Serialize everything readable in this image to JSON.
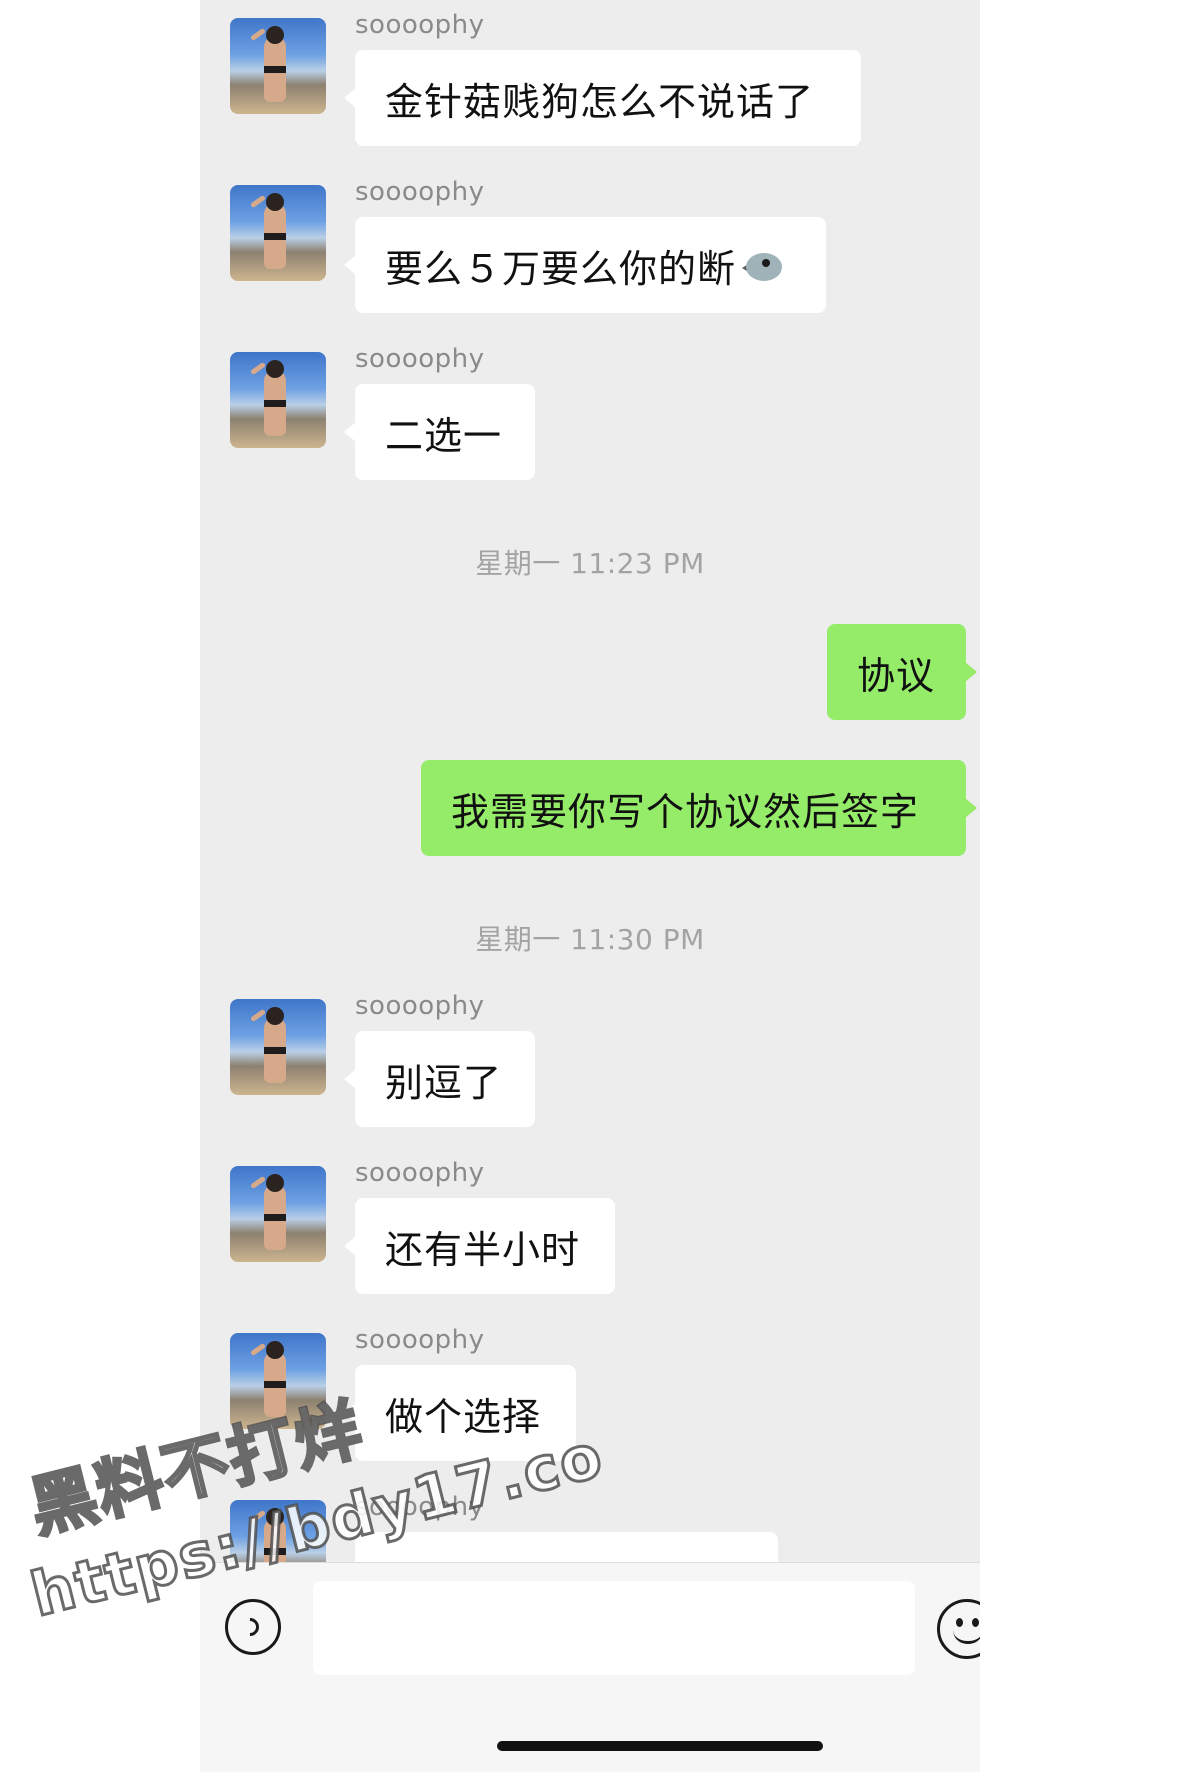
{
  "sender_name": "soooophy",
  "messages": [
    {
      "type": "in",
      "sender": "soooophy",
      "text": "金针菇贱狗怎么不说话了"
    },
    {
      "type": "in",
      "sender": "soooophy",
      "text": "要么５万要么你的断",
      "emoji": "bird-emoji"
    },
    {
      "type": "in",
      "sender": "soooophy",
      "text": "二选一"
    },
    {
      "type": "time",
      "text": "星期一 11:23 PM"
    },
    {
      "type": "out",
      "text": "协议"
    },
    {
      "type": "out",
      "text": "我需要你写个协议然后签字"
    },
    {
      "type": "time",
      "text": "星期一 11:30 PM"
    },
    {
      "type": "in",
      "sender": "soooophy",
      "text": "别逗了"
    },
    {
      "type": "in",
      "sender": "soooophy",
      "text": "还有半小时"
    },
    {
      "type": "in",
      "sender": "soooophy",
      "text": "做个选择"
    },
    {
      "type": "in",
      "sender": "soooophy",
      "text": ""
    }
  ],
  "input_bar": {
    "voice_icon": "voice-icon",
    "emoji_icon": "emoji-icon",
    "text_value": ""
  },
  "watermark": {
    "line1": "黑料不打烊",
    "line2": "https://bdy17.co"
  },
  "colors": {
    "chat_background": "#ededed",
    "outgoing_bubble": "#95ec69",
    "incoming_bubble": "#ffffff"
  }
}
